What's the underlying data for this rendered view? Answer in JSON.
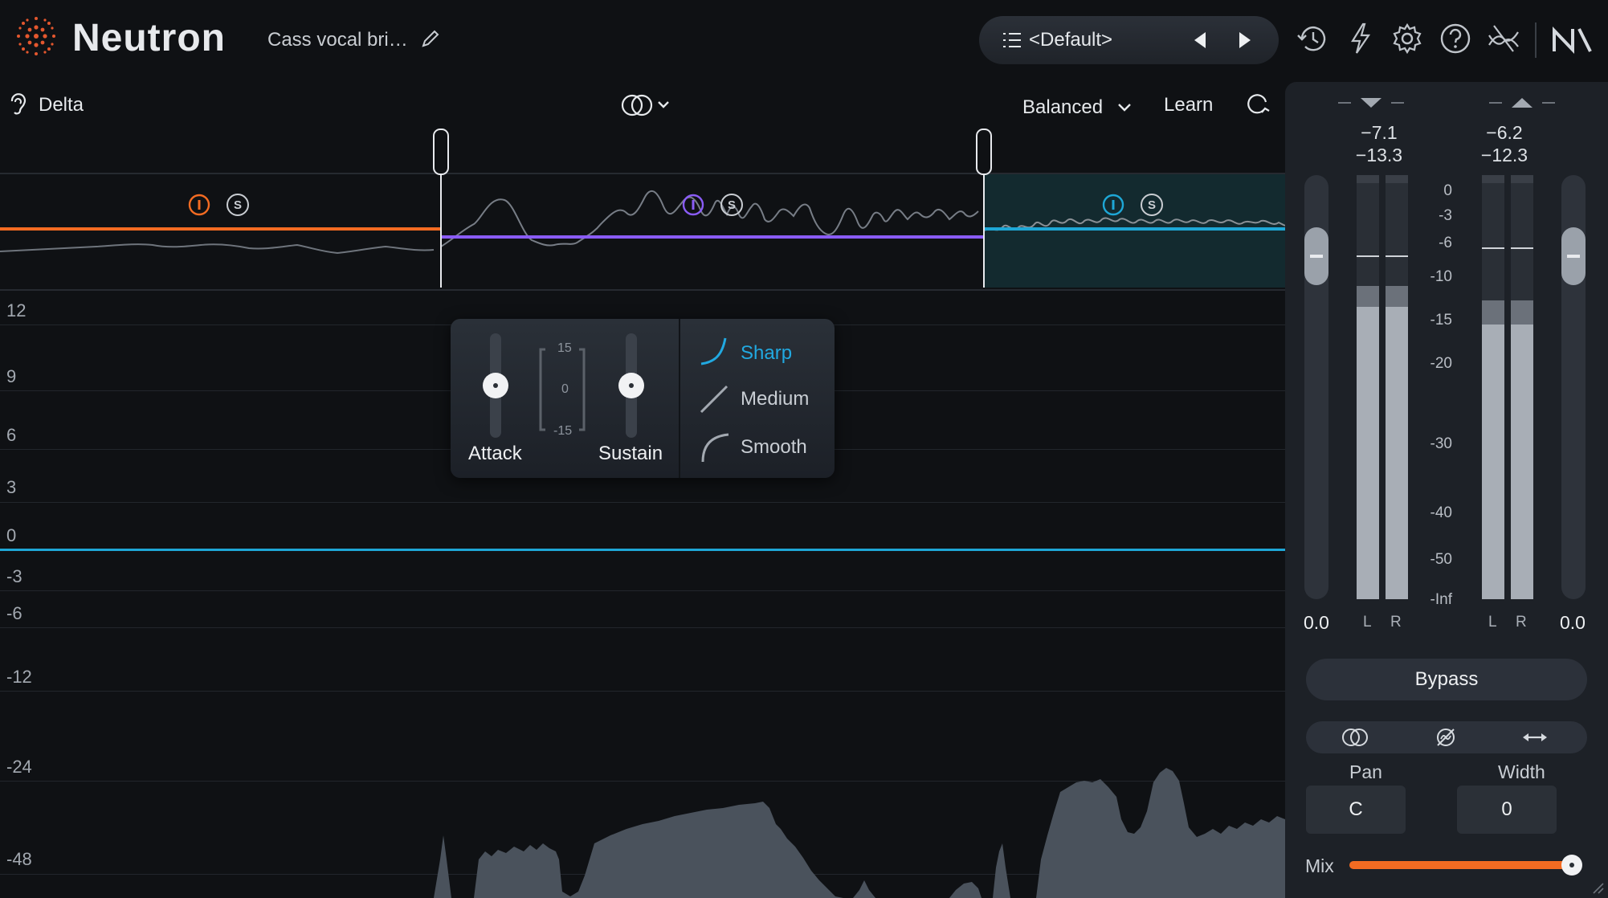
{
  "app": {
    "name": "Neutron"
  },
  "header": {
    "preset_name": "Cass vocal bri…",
    "preset_selector": "<Default>"
  },
  "toolbar": {
    "delta_label": "Delta",
    "mode": "Balanced",
    "learn_label": "Learn"
  },
  "bands": {
    "band1_solo": "S",
    "band2_solo": "S",
    "band3_solo": "S"
  },
  "graph": {
    "db_labels": [
      "12",
      "9",
      "6",
      "3",
      "0",
      "-3",
      "-6",
      "-12",
      "-24",
      "-48"
    ]
  },
  "popup": {
    "attack_label": "Attack",
    "sustain_label": "Sustain",
    "scale_top": "15",
    "scale_mid": "0",
    "scale_bottom": "-15",
    "curve_sharp": "Sharp",
    "curve_medium": "Medium",
    "curve_smooth": "Smooth",
    "selected_curve": "Sharp"
  },
  "meters": {
    "input_peak": "−7.1",
    "input_rms": "−13.3",
    "output_peak": "−6.2",
    "output_rms": "−12.3",
    "scale": [
      "0",
      "-3",
      "-6",
      "-10",
      "-15",
      "-20",
      "-30",
      "-40",
      "-50",
      "-Inf"
    ],
    "input_gain": "0.0",
    "output_gain": "0.0",
    "left": "L",
    "right": "R"
  },
  "panel": {
    "bypass_label": "Bypass",
    "pan_label": "Pan",
    "width_label": "Width",
    "pan_value": "C",
    "width_value": "0",
    "mix_label": "Mix"
  },
  "colors": {
    "band1": "#f36b22",
    "band2": "#8a5cf6",
    "band3": "#1ea7d6",
    "accent_blue": "#21a9e1",
    "mix_orange": "#f36b22"
  }
}
